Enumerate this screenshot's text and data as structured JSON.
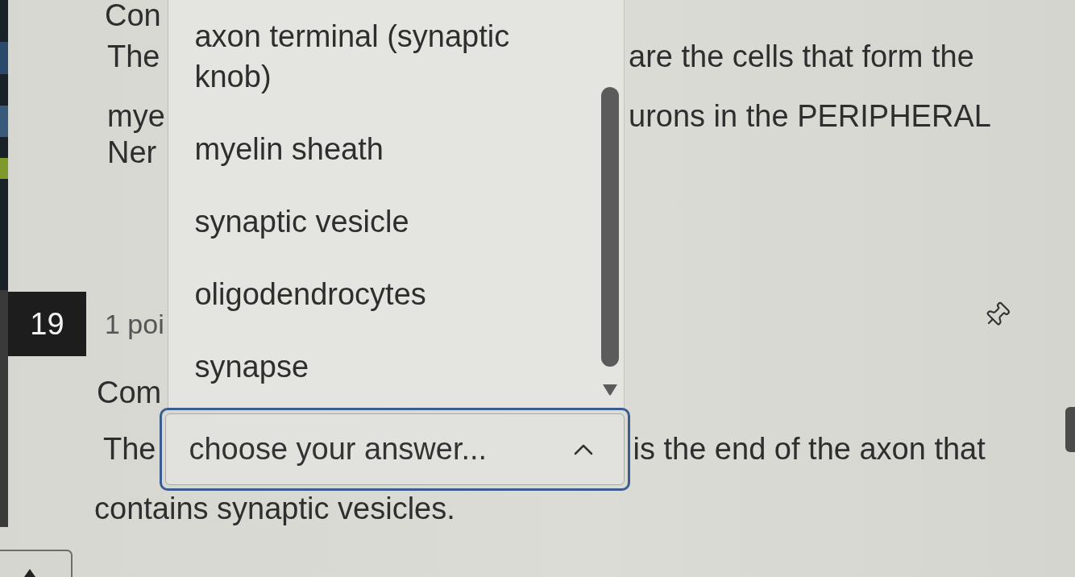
{
  "question_18": {
    "heading": "Con",
    "text_lines": [
      {
        "start": "The",
        "end": "are the cells that form the"
      },
      {
        "start": "mye",
        "end": "urons in the PERIPHERAL"
      },
      {
        "start": "Ner"
      }
    ]
  },
  "question_19": {
    "number": "19",
    "points": "1 poi",
    "heading": "Com",
    "text_before": "The",
    "answer_select": {
      "placeholder": "choose your answer...",
      "focused": true,
      "expanded": true,
      "options": [
        {
          "label": "axon terminal (synaptic knob)",
          "selected": false
        },
        {
          "label": "myelin sheath",
          "selected": false
        },
        {
          "label": "synaptic vesicle",
          "selected": false
        },
        {
          "label": "oligodendrocytes",
          "selected": false
        },
        {
          "label": "synapse",
          "selected": false
        }
      ]
    },
    "text_after": "is the end of the axon that",
    "text_continued": "contains synaptic vesicles."
  }
}
